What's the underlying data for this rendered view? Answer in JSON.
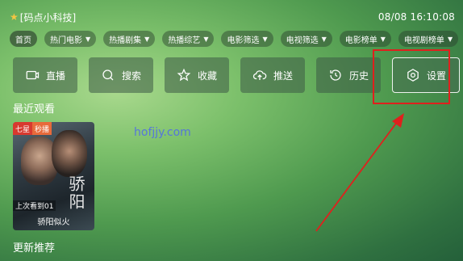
{
  "header": {
    "title": "[码点小科技]",
    "datetime": "08/08 16:10:08"
  },
  "categories": [
    {
      "label": "首页",
      "dropdown": false
    },
    {
      "label": "热门电影",
      "dropdown": true
    },
    {
      "label": "热播剧集",
      "dropdown": true
    },
    {
      "label": "热播综艺",
      "dropdown": true
    },
    {
      "label": "电影筛选",
      "dropdown": true
    },
    {
      "label": "电视筛选",
      "dropdown": true
    },
    {
      "label": "电影榜单",
      "dropdown": true
    },
    {
      "label": "电视剧榜单",
      "dropdown": true
    }
  ],
  "actions": [
    {
      "label": "直播",
      "icon": "tv-icon"
    },
    {
      "label": "搜索",
      "icon": "search-icon"
    },
    {
      "label": "收藏",
      "icon": "star-icon"
    },
    {
      "label": "推送",
      "icon": "cloud-upload-icon"
    },
    {
      "label": "历史",
      "icon": "history-icon"
    },
    {
      "label": "设置",
      "icon": "settings-icon"
    }
  ],
  "sections": {
    "recent": "最近观看",
    "update": "更新推荐"
  },
  "recent_items": [
    {
      "badge_left": "七星",
      "badge_right": "秒播",
      "progress": "上次看到01",
      "name": "骄阳似火",
      "art_title": "骄阳"
    }
  ],
  "watermark": "hofjjy.com",
  "colors": {
    "highlight": "#e0201d",
    "accent_star": "#f5c542"
  }
}
